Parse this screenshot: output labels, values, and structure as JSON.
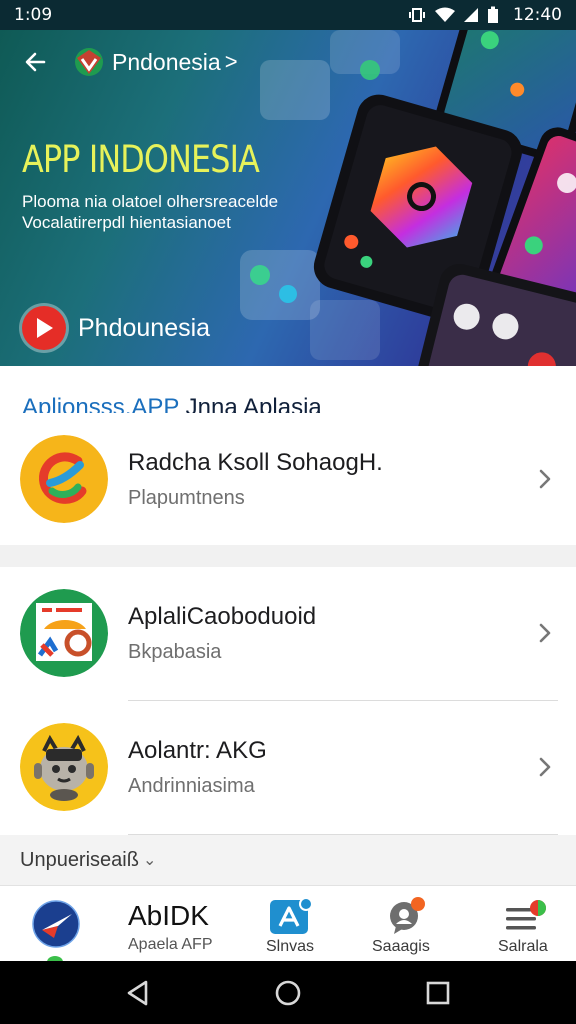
{
  "status_bar": {
    "time": "1:09",
    "clock": "12:40"
  },
  "hero": {
    "brand": "Pndonesia",
    "brand_chevron": ">",
    "title": "APP INDONESIA",
    "subtitle_line1": "Plooma nia olatoel olhersreacelde",
    "subtitle_line2": "Vocalatirerpdl hientasianoet",
    "cta_label": "Phdounesia"
  },
  "section": {
    "title_part1": "Aplionsss,APP",
    "title_part2": " Jnna Aplasia"
  },
  "apps": [
    {
      "name": "Radcha Ksoll SohaogH.",
      "subtitle": "Plapumtnens"
    },
    {
      "name": "AplaliCaoboduoid",
      "subtitle": "Bkpabasia"
    },
    {
      "name": "Aolantr: AKG",
      "subtitle": "Andrinniasima"
    }
  ],
  "more": {
    "label": "Unpueriseaiß",
    "chevron": "⌄"
  },
  "bottom_nav": {
    "home_title": "AbIDK",
    "home_sub": "Apaela AFP",
    "items": [
      "Slnvas",
      "Saaagis",
      "Salrala"
    ]
  },
  "colors": {
    "status_bar": "#0b2a33",
    "hero_title": "#e7f25a",
    "section_title_accent": "#1b6fbd",
    "section_title": "#10203a",
    "play_badge": "#e52d27",
    "nav_accent": "#1f8fcf",
    "badge_orange": "#f26522"
  },
  "icons": [
    "back-arrow-icon",
    "hero-logo-icon",
    "play-icon",
    "chevron-right-icon",
    "compass-icon",
    "drive-icon",
    "chat-icon",
    "menu-icon",
    "signal-icon",
    "wifi-icon",
    "battery-icon"
  ]
}
